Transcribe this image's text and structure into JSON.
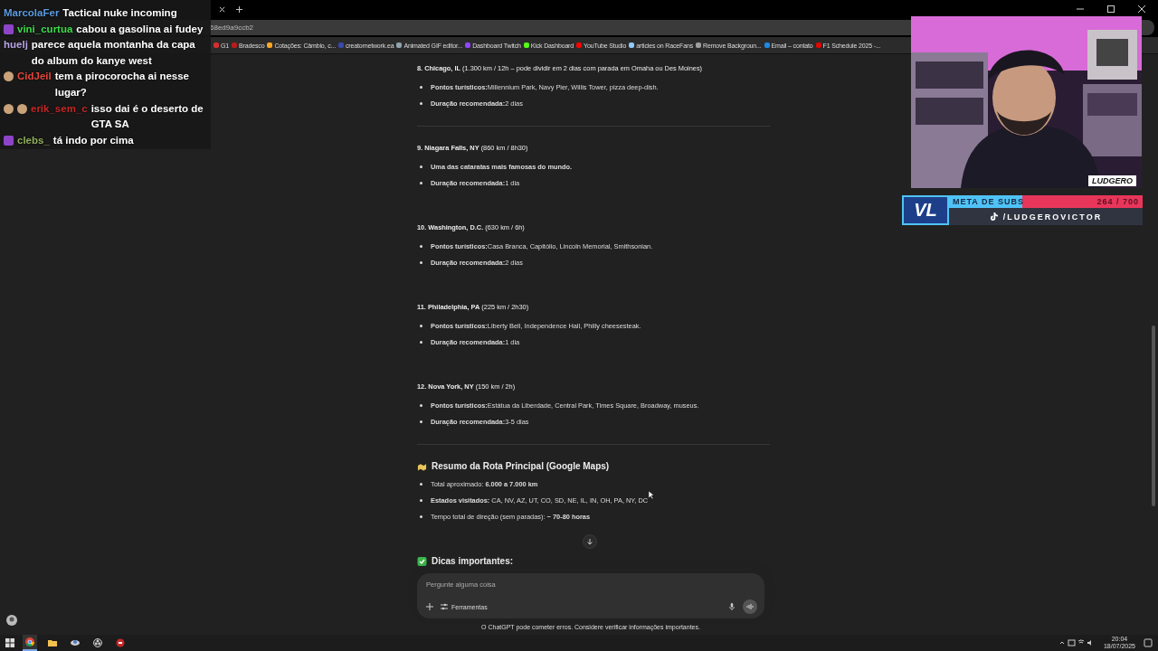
{
  "browser": {
    "url_fragment": "68ed9a9ccb2",
    "bookmarks": [
      {
        "label": "G1",
        "color": "#d32f2f"
      },
      {
        "label": "Bradesco",
        "color": "#b71c1c"
      },
      {
        "label": "Cotações: Câmbio, c...",
        "color": "#f9a825"
      },
      {
        "label": "creatornetwork.ea",
        "color": "#3949ab"
      },
      {
        "label": "Animated GIF editor...",
        "color": "#90a4ae"
      },
      {
        "label": "Dashboard Twitch",
        "color": "#9146ff"
      },
      {
        "label": "Kick Dashboard",
        "color": "#53fc18"
      },
      {
        "label": "YouTube Studio",
        "color": "#ff0000"
      },
      {
        "label": "articles on RaceFans",
        "color": "#90caf9"
      },
      {
        "label": "Remove Backgroun...",
        "color": "#9e9e9e"
      },
      {
        "label": "Email – contato",
        "color": "#1e88e5"
      },
      {
        "label": "F1 Schedule 2025 -...",
        "color": "#e10600"
      }
    ]
  },
  "stops": [
    {
      "title": "8. Chicago, IL",
      "detail": "(1.300 km / 12h – pode dividir em 2 dias com parada em Omaha ou Des Moines)",
      "divider_after": true,
      "bullets": [
        {
          "label": "Pontos turísticos:",
          "value": "Millennium Park, Navy Pier, Willis Tower, pizza deep-dish."
        },
        {
          "label": "Duração recomendada:",
          "value": "2 dias"
        }
      ]
    },
    {
      "title": "9. Niagara Falls, NY",
      "detail": "(860 km / 8h30)",
      "divider_after": false,
      "bullets": [
        {
          "label": "Uma das cataratas mais famosas do mundo."
        },
        {
          "label": "Duração recomendada:",
          "value": "1 dia"
        }
      ]
    },
    {
      "title": "10. Washington, D.C.",
      "detail": "(630 km / 6h)",
      "divider_after": false,
      "bullets": [
        {
          "label": "Pontos turísticos:",
          "value": "Casa Branca, Capitólio, Lincoln Memorial, Smithsonian."
        },
        {
          "label": "Duração recomendada:",
          "value": "2 dias"
        }
      ]
    },
    {
      "title": "11. Philadelphia, PA",
      "detail": "(225 km / 2h30)",
      "divider_after": false,
      "bullets": [
        {
          "label": "Pontos turísticos:",
          "value": "Liberty Bell, Independence Hall, Philly cheesesteak."
        },
        {
          "label": "Duração recomendada:",
          "value": "1 dia"
        }
      ]
    },
    {
      "title": "12. Nova York, NY",
      "detail": "(150 km / 2h)",
      "divider_after": true,
      "bullets": [
        {
          "label": "Pontos turísticos:",
          "value": "Estátua da Liberdade, Central Park, Times Square, Broadway, museus."
        },
        {
          "label": "Duração recomendada:",
          "value": "3-5 dias"
        }
      ]
    }
  ],
  "summary": {
    "heading": "Resumo da Rota Principal (Google Maps)",
    "bullets": [
      "Total aproximado: **6.000 a 7.000 km**",
      "**Estados visitados:** CA, NV, AZ, UT, CO, SD, NE, IL, IN, OH, PA, NY, DC",
      "Tempo total de direção (sem paradas): **~ 70-80 horas**"
    ]
  },
  "next_heading": "Dicas importantes:",
  "composer": {
    "placeholder": "Pergunte alguma coisa",
    "tools": "Ferramentas",
    "disclaimer": "O ChatGPT pode cometer erros. Considere verificar informações importantes."
  },
  "chat_overlay": {
    "messages": [
      {
        "user": "MarcolaFer",
        "color": "#5b9be0",
        "text": "Tactical nuke incoming"
      },
      {
        "user": "vini_curtua",
        "color": "#3ddc4a",
        "text": "cabou a gasolina ai fudey",
        "badges": [
          {
            "kind": "sub"
          }
        ]
      },
      {
        "user": "huelj",
        "color": "#b9a6e8",
        "text": "parece aquela montanha da capa do album do kanye west"
      },
      {
        "user": "CidJeil",
        "color": "#e5463a",
        "text": "tem a pirocorocha ai nesse lugar?",
        "badges": [
          {
            "kind": "round"
          }
        ]
      },
      {
        "user": "erik_sem_c",
        "color": "#c62828",
        "text": "isso dai é o deserto de GTA SA",
        "badges": [
          {
            "kind": "round"
          },
          {
            "kind": "round"
          }
        ]
      },
      {
        "user": "clebs_",
        "color": "#8fae5a",
        "text": "tá indo por cima",
        "badges": [
          {
            "kind": "sub"
          }
        ]
      }
    ]
  },
  "stream_overlay": {
    "logo": "LUDGERO",
    "badge": "VL",
    "goal_label": "META DE SUBS",
    "goal_count": "264 / 700",
    "level": 0.377,
    "handle": "/LUDGEROVICTOR"
  },
  "taskbar": {
    "apps": [
      {
        "kind": "chrome",
        "selected": true
      },
      {
        "kind": "folder",
        "selected": false
      },
      {
        "kind": "app",
        "selected": false
      },
      {
        "kind": "obs",
        "selected": false
      },
      {
        "kind": "red",
        "selected": false
      }
    ],
    "time": "20:04",
    "date": "18/07/2025"
  }
}
